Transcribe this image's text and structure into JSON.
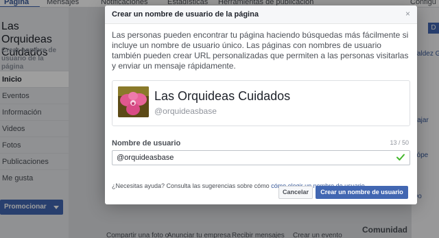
{
  "background": {
    "topnav": [
      "Página",
      "Mensajes",
      "Notificaciones",
      "Estadísticas",
      "Herramientas de publicación",
      "Configu"
    ],
    "page_name": "Las Orquideas Cuidados",
    "create_username_link": "Crear nombre de usuario de la página",
    "nav_items": [
      "Inicio",
      "Eventos",
      "Información",
      "Videos",
      "Fotos",
      "Publicaciones",
      "Me gusta"
    ],
    "promote_label": "Promocionar",
    "bottom_cards": [
      "Compartir una foto o",
      "Anunciar tu empresa",
      "Recibir mensajes",
      "Crear un evento"
    ],
    "right_col": [
      "Valdez Gl",
      "Fajar",
      "Lópe",
      "Do"
    ],
    "right_col_badge": "D",
    "comunidad_label": "Comunidad"
  },
  "dialog": {
    "title": "Crear un nombre de usuario de la página",
    "close_glyph": "×",
    "intro": "Las personas pueden encontrar tu página haciendo búsquedas más fácilmente si incluye un nombre de usuario único. Las páginas con nombres de usuario también pueden crear URL personalizadas que permiten a las personas visitarlas y enviar un mensaje rápidamente.",
    "preview": {
      "name": "Las Orquideas Cuidados",
      "handle": "@orquideasbase"
    },
    "field_label": "Nombre de usuario",
    "char_count": "13 / 50",
    "username_value": "@orquideasbase",
    "help_prefix": "¿Necesitas ayuda? Consulta las sugerencias sobre cómo ",
    "help_link": "cómo elegir un nombre de usuario",
    "help_suffix": ".",
    "cancel_label": "Cancelar",
    "create_label": "Crear un nombre de usuario"
  },
  "colors": {
    "brand": "#4267b2",
    "link": "#365899",
    "valid_check": "#42b72a"
  }
}
